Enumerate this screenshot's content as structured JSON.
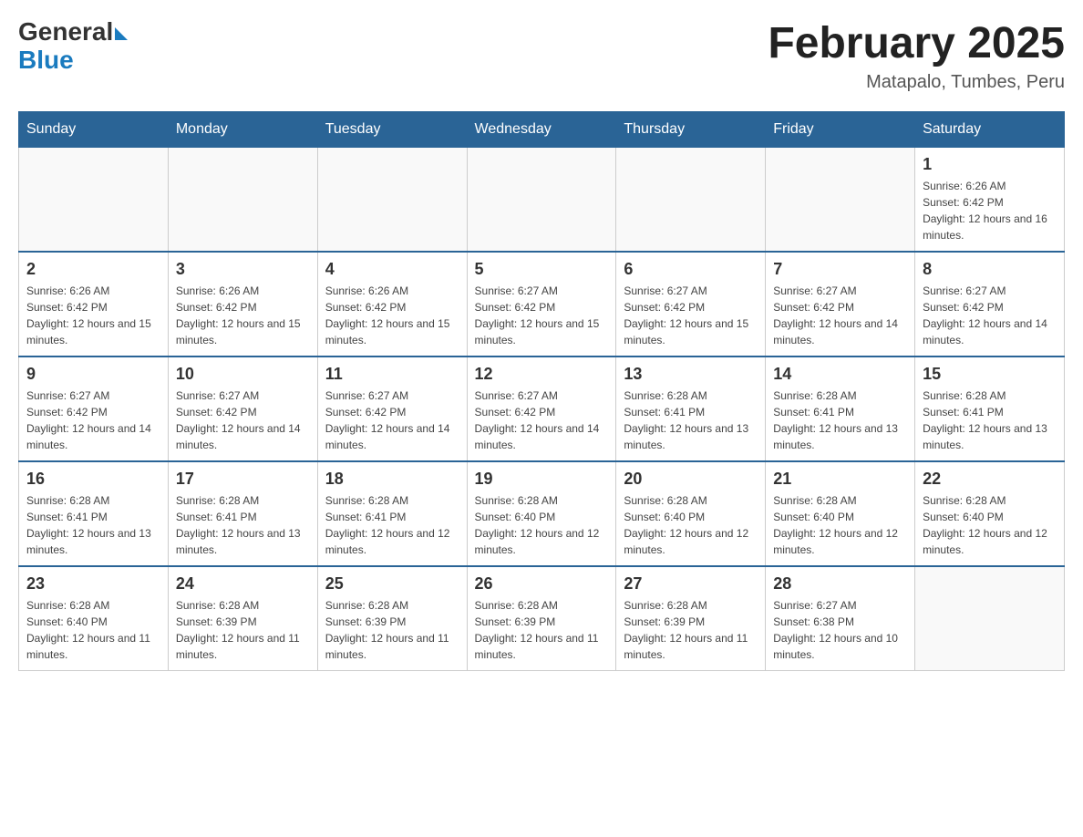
{
  "header": {
    "logo_general": "General",
    "logo_blue": "Blue",
    "month_title": "February 2025",
    "location": "Matapalo, Tumbes, Peru"
  },
  "days_of_week": [
    "Sunday",
    "Monday",
    "Tuesday",
    "Wednesday",
    "Thursday",
    "Friday",
    "Saturday"
  ],
  "weeks": [
    [
      {
        "day": "",
        "info": ""
      },
      {
        "day": "",
        "info": ""
      },
      {
        "day": "",
        "info": ""
      },
      {
        "day": "",
        "info": ""
      },
      {
        "day": "",
        "info": ""
      },
      {
        "day": "",
        "info": ""
      },
      {
        "day": "1",
        "info": "Sunrise: 6:26 AM\nSunset: 6:42 PM\nDaylight: 12 hours and 16 minutes."
      }
    ],
    [
      {
        "day": "2",
        "info": "Sunrise: 6:26 AM\nSunset: 6:42 PM\nDaylight: 12 hours and 15 minutes."
      },
      {
        "day": "3",
        "info": "Sunrise: 6:26 AM\nSunset: 6:42 PM\nDaylight: 12 hours and 15 minutes."
      },
      {
        "day": "4",
        "info": "Sunrise: 6:26 AM\nSunset: 6:42 PM\nDaylight: 12 hours and 15 minutes."
      },
      {
        "day": "5",
        "info": "Sunrise: 6:27 AM\nSunset: 6:42 PM\nDaylight: 12 hours and 15 minutes."
      },
      {
        "day": "6",
        "info": "Sunrise: 6:27 AM\nSunset: 6:42 PM\nDaylight: 12 hours and 15 minutes."
      },
      {
        "day": "7",
        "info": "Sunrise: 6:27 AM\nSunset: 6:42 PM\nDaylight: 12 hours and 14 minutes."
      },
      {
        "day": "8",
        "info": "Sunrise: 6:27 AM\nSunset: 6:42 PM\nDaylight: 12 hours and 14 minutes."
      }
    ],
    [
      {
        "day": "9",
        "info": "Sunrise: 6:27 AM\nSunset: 6:42 PM\nDaylight: 12 hours and 14 minutes."
      },
      {
        "day": "10",
        "info": "Sunrise: 6:27 AM\nSunset: 6:42 PM\nDaylight: 12 hours and 14 minutes."
      },
      {
        "day": "11",
        "info": "Sunrise: 6:27 AM\nSunset: 6:42 PM\nDaylight: 12 hours and 14 minutes."
      },
      {
        "day": "12",
        "info": "Sunrise: 6:27 AM\nSunset: 6:42 PM\nDaylight: 12 hours and 14 minutes."
      },
      {
        "day": "13",
        "info": "Sunrise: 6:28 AM\nSunset: 6:41 PM\nDaylight: 12 hours and 13 minutes."
      },
      {
        "day": "14",
        "info": "Sunrise: 6:28 AM\nSunset: 6:41 PM\nDaylight: 12 hours and 13 minutes."
      },
      {
        "day": "15",
        "info": "Sunrise: 6:28 AM\nSunset: 6:41 PM\nDaylight: 12 hours and 13 minutes."
      }
    ],
    [
      {
        "day": "16",
        "info": "Sunrise: 6:28 AM\nSunset: 6:41 PM\nDaylight: 12 hours and 13 minutes."
      },
      {
        "day": "17",
        "info": "Sunrise: 6:28 AM\nSunset: 6:41 PM\nDaylight: 12 hours and 13 minutes."
      },
      {
        "day": "18",
        "info": "Sunrise: 6:28 AM\nSunset: 6:41 PM\nDaylight: 12 hours and 12 minutes."
      },
      {
        "day": "19",
        "info": "Sunrise: 6:28 AM\nSunset: 6:40 PM\nDaylight: 12 hours and 12 minutes."
      },
      {
        "day": "20",
        "info": "Sunrise: 6:28 AM\nSunset: 6:40 PM\nDaylight: 12 hours and 12 minutes."
      },
      {
        "day": "21",
        "info": "Sunrise: 6:28 AM\nSunset: 6:40 PM\nDaylight: 12 hours and 12 minutes."
      },
      {
        "day": "22",
        "info": "Sunrise: 6:28 AM\nSunset: 6:40 PM\nDaylight: 12 hours and 12 minutes."
      }
    ],
    [
      {
        "day": "23",
        "info": "Sunrise: 6:28 AM\nSunset: 6:40 PM\nDaylight: 12 hours and 11 minutes."
      },
      {
        "day": "24",
        "info": "Sunrise: 6:28 AM\nSunset: 6:39 PM\nDaylight: 12 hours and 11 minutes."
      },
      {
        "day": "25",
        "info": "Sunrise: 6:28 AM\nSunset: 6:39 PM\nDaylight: 12 hours and 11 minutes."
      },
      {
        "day": "26",
        "info": "Sunrise: 6:28 AM\nSunset: 6:39 PM\nDaylight: 12 hours and 11 minutes."
      },
      {
        "day": "27",
        "info": "Sunrise: 6:28 AM\nSunset: 6:39 PM\nDaylight: 12 hours and 11 minutes."
      },
      {
        "day": "28",
        "info": "Sunrise: 6:27 AM\nSunset: 6:38 PM\nDaylight: 12 hours and 10 minutes."
      },
      {
        "day": "",
        "info": ""
      }
    ]
  ]
}
